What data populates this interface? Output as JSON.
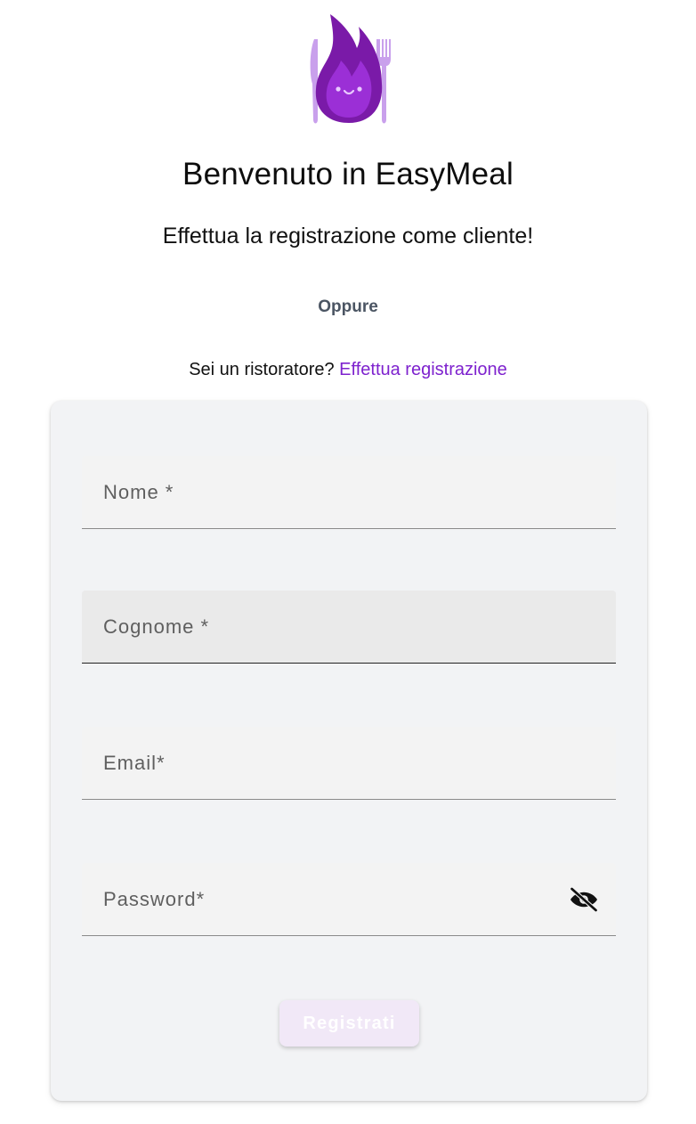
{
  "header": {
    "logo": "easymeal-flame-mascot-logo",
    "title": "Benvenuto in EasyMeal",
    "subtitle": "Effettua la registrazione come cliente!",
    "separator": "Oppure",
    "restaurant_prompt": "Sei un ristoratore?",
    "restaurant_link": "Effettua registrazione"
  },
  "form": {
    "fields": [
      {
        "name": "nome",
        "placeholder": "Nome *",
        "value": ""
      },
      {
        "name": "cognome",
        "placeholder": "Cognome *",
        "value": ""
      },
      {
        "name": "email",
        "placeholder": "Email*",
        "value": ""
      },
      {
        "name": "password",
        "placeholder": "Password*",
        "value": ""
      }
    ],
    "password_toggle_icon": "eye-off-icon",
    "submit_label": "Registrati"
  },
  "colors": {
    "accent": "#7e22ce",
    "logo_purple": "#8e1fc6",
    "card_background": "#f2f3f5",
    "button_background_disabled": "#f1e8f7"
  }
}
